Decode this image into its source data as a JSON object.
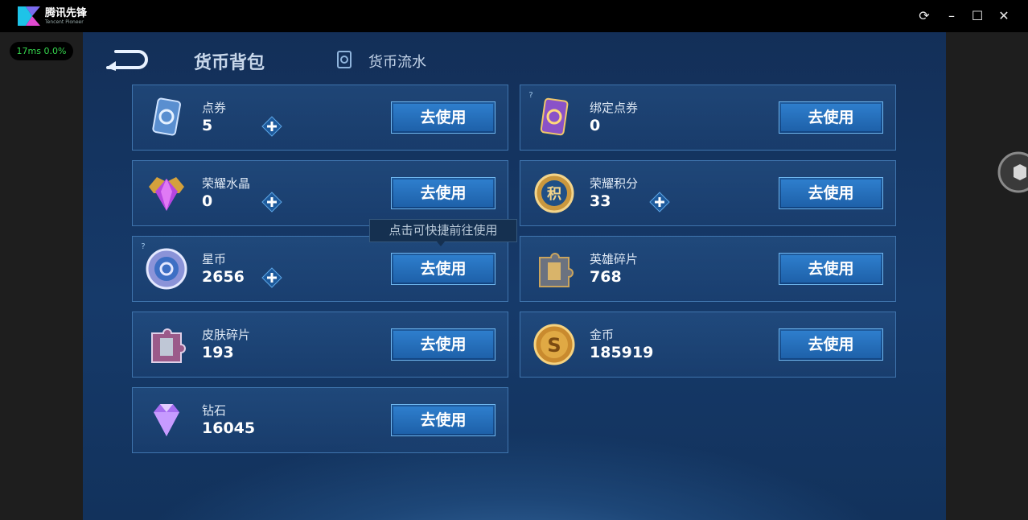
{
  "window": {
    "title": "腾讯先锋",
    "subtitle": "Tencent Pioneer",
    "fps_readout": "17ms  0.0%"
  },
  "header": {
    "active_tab": "货币背包",
    "other_tab": "货币流水"
  },
  "tooltip": "点击可快捷前往使用",
  "use_label": "去使用",
  "currencies": [
    {
      "name": "点券",
      "value": "5",
      "icon": "voucher-icon"
    },
    {
      "name": "绑定点券",
      "value": "0",
      "icon": "bound-voucher-icon"
    },
    {
      "name": "荣耀水晶",
      "value": "0",
      "icon": "glory-crystal-icon"
    },
    {
      "name": "荣耀积分",
      "value": "33",
      "icon": "glory-points-icon"
    },
    {
      "name": "星币",
      "value": "2656",
      "icon": "star-coin-icon"
    },
    {
      "name": "英雄碎片",
      "value": "768",
      "icon": "hero-shard-icon"
    },
    {
      "name": "皮肤碎片",
      "value": "193",
      "icon": "skin-shard-icon"
    },
    {
      "name": "金币",
      "value": "185919",
      "icon": "gold-coin-icon"
    },
    {
      "name": "钻石",
      "value": "16045",
      "icon": "diamond-icon"
    }
  ],
  "glyphs": {
    "points_badge": "积",
    "gold_badge": "S",
    "question": "?"
  },
  "colors": {
    "accent": "#2f80cf",
    "panel_border": "#3f74ad",
    "fps_text": "#35d64d"
  }
}
